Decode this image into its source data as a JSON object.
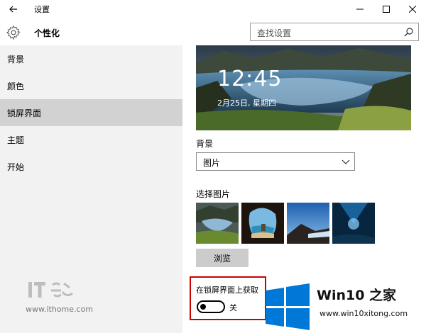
{
  "titlebar": {
    "title": "设置",
    "back_icon": "arrow-left-icon",
    "controls": [
      "minimize-icon",
      "maximize-icon",
      "close-icon"
    ]
  },
  "header": {
    "section_title": "个性化",
    "icon": "gear-icon",
    "search_placeholder": "查找设置"
  },
  "sidebar": {
    "items": [
      {
        "label": "背景",
        "selected": false
      },
      {
        "label": "颜色",
        "selected": false
      },
      {
        "label": "锁屏界面",
        "selected": true
      },
      {
        "label": "主题",
        "selected": false
      },
      {
        "label": "开始",
        "selected": false
      }
    ]
  },
  "lockscreen": {
    "preview_time": "12:45",
    "preview_date": "2月25日, 星期四",
    "background_label": "背景",
    "background_value": "图片",
    "choose_picture_label": "选择图片",
    "browse_button": "浏览",
    "tips_label": "在锁屏界面上获取",
    "toggle_state": "关",
    "toggle_on": false
  },
  "watermarks": {
    "ithome_logo_text": "IT之家",
    "ithome_url": "www.ithome.com",
    "win10_brand": "Win10 之家",
    "win10_url": "www.win10xitong.com"
  },
  "colors": {
    "sidebar_bg": "#f2f2f2",
    "selected_item_bg": "#d2d2d2",
    "highlight_border": "#c80000",
    "windows_logo_blue": "#0078d7"
  }
}
